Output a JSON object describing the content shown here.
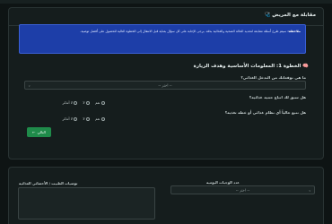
{
  "card_title": "مقابلة مع المريض 🩺",
  "alert": {
    "bold": "ملاحظة:",
    "text": "سيتم طرح أسئلة متتابعة لتحديد الحالة الصحية والغذائية بدقة. يرجى الإجابة على كل سؤال بعناية قبل الانتقال إلى الخطوة التالية للحصول على أفضل توصية."
  },
  "step_title": "🧠 الخطوة 1: المعلومات الأساسية وهدف الزيارة",
  "q1": {
    "label": "ما هي توقعاتك من التدخل الغذائي؟",
    "select": "-- اختر --"
  },
  "q2": {
    "label": "هل سبق لك اتباع حمية غذائية؟",
    "options": [
      "نعم",
      "لا",
      "لا أتذكر"
    ]
  },
  "q3": {
    "label": "هل تتبع حالياً أي نظام غذائي أو خطة تغذية؟",
    "options": [
      "نعم",
      "لا",
      "لا أتذكر"
    ]
  },
  "next_button": "التالي",
  "next_icon": "arrow-left-icon",
  "bottom": {
    "meals_label": "عدد الوجبات اليومية",
    "meals_select": "-- اختر --",
    "notes_label": "توصيات الطبيب / الأخصائي الغذائية"
  },
  "colors": {
    "accent": "#1d3ea8",
    "button": "#1f8b4a",
    "bg": "#0e1414"
  }
}
